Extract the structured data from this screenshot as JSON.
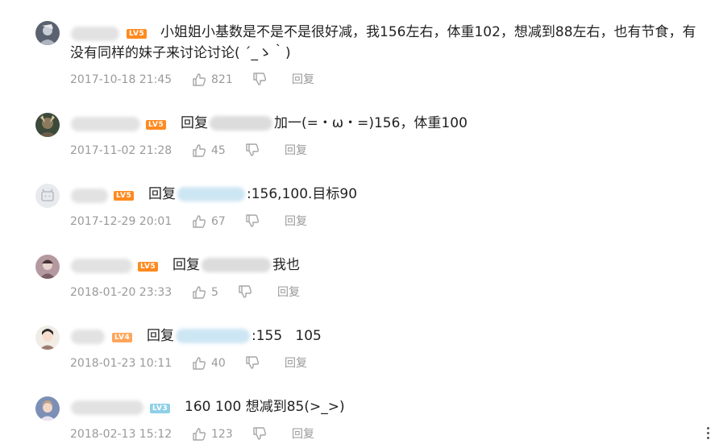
{
  "comments": [
    {
      "level": "LV5",
      "text_line1": "小姐姐小基数是不是不是很好减，我156左右，体重102，想减到88左右，也有节食，有",
      "text_line2": "没有同样的妹子来讨论讨论( ´_ゝ｀)",
      "time": "2017-10-18 21:45",
      "likes": "821",
      "reply_label": "回复"
    },
    {
      "level": "LV5",
      "reply_prefix": "回复",
      "text": "加一(=・ω・=)156，体重100",
      "time": "2017-11-02 21:28",
      "likes": "45",
      "reply_label": "回复"
    },
    {
      "level": "LV5",
      "reply_prefix": "回复",
      "text": ":156,100.目标90",
      "time": "2017-12-29 20:01",
      "likes": "67",
      "reply_label": "回复"
    },
    {
      "level": "LV5",
      "reply_prefix": "回复",
      "text": "我也",
      "time": "2018-01-20 23:33",
      "likes": "5",
      "reply_label": "回复"
    },
    {
      "level": "LV4",
      "reply_prefix": "回复",
      "text": ":155   105",
      "time": "2018-01-23 10:11",
      "likes": "40",
      "reply_label": "回复"
    },
    {
      "level": "LV3",
      "text": "160 100 想减到85(>_>)",
      "time": "2018-02-13 15:12",
      "likes": "123",
      "reply_label": "回复"
    }
  ],
  "colors": {
    "level5": "#ff8a1f",
    "level4": "#ffa55a",
    "level3": "#8fd0e8",
    "meta_text": "#9a9a9a"
  },
  "icons": [
    "like-icon",
    "dislike-icon",
    "more-options-icon"
  ]
}
